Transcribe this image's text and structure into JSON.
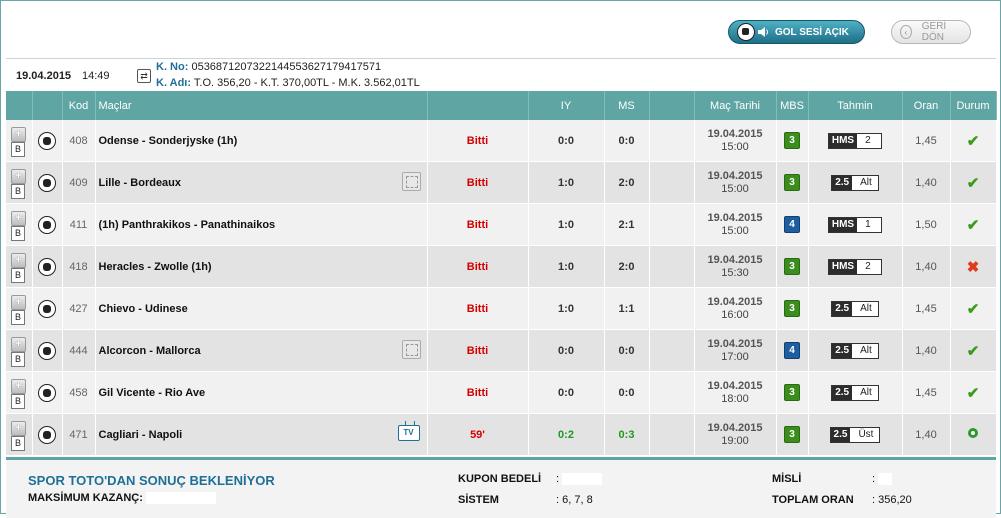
{
  "header": {
    "gol_button": "GOL SESİ AÇIK",
    "geri_button": "GERİ DÖN"
  },
  "coupon": {
    "date": "19.04.2015",
    "time": "14:49",
    "kno_label": "K. No:",
    "kno_value": "0536871207322144553627179417571",
    "kadi_label": "K. Adı:",
    "kadi_value": "T.O. 356,20 - K.T. 370,00TL - M.K. 3.562,01TL"
  },
  "columns": {
    "kod": "Kod",
    "maclar": "Maçlar",
    "iy": "IY",
    "ms": "MS",
    "mac_tarihi": "Maç Tarihi",
    "mbs": "MBS",
    "tahmin": "Tahmin",
    "oran": "Oran",
    "durum": "Durum"
  },
  "rows": [
    {
      "kod": "408",
      "mac": "Odense - Sonderjyske (1h)",
      "status": "Bitti",
      "iy": "0:0",
      "ms": "0:0",
      "date": "19.04.2015",
      "time": "15:00",
      "mbs": "3",
      "mbs_color": "green",
      "tahmin_key": "HMS",
      "tahmin_val": "2",
      "oran": "1,45",
      "durum": "won",
      "icon": ""
    },
    {
      "kod": "409",
      "mac": "Lille - Bordeaux",
      "status": "Bitti",
      "iy": "1:0",
      "ms": "2:0",
      "date": "19.04.2015",
      "time": "15:00",
      "mbs": "3",
      "mbs_color": "green",
      "tahmin_key": "2.5",
      "tahmin_val": "Alt",
      "oran": "1,40",
      "durum": "won",
      "icon": "stats"
    },
    {
      "kod": "411",
      "mac": "(1h) Panthrakikos - Panathinaikos",
      "status": "Bitti",
      "iy": "1:0",
      "ms": "2:1",
      "date": "19.04.2015",
      "time": "15:00",
      "mbs": "4",
      "mbs_color": "blue",
      "tahmin_key": "HMS",
      "tahmin_val": "1",
      "oran": "1,50",
      "durum": "won",
      "icon": ""
    },
    {
      "kod": "418",
      "mac": "Heracles - Zwolle (1h)",
      "status": "Bitti",
      "iy": "1:0",
      "ms": "2:0",
      "date": "19.04.2015",
      "time": "15:30",
      "mbs": "3",
      "mbs_color": "green",
      "tahmin_key": "HMS",
      "tahmin_val": "2",
      "oran": "1,40",
      "durum": "lost",
      "icon": ""
    },
    {
      "kod": "427",
      "mac": "Chievo - Udinese",
      "status": "Bitti",
      "iy": "1:0",
      "ms": "1:1",
      "date": "19.04.2015",
      "time": "16:00",
      "mbs": "3",
      "mbs_color": "green",
      "tahmin_key": "2.5",
      "tahmin_val": "Alt",
      "oran": "1,45",
      "durum": "won",
      "icon": ""
    },
    {
      "kod": "444",
      "mac": "Alcorcon - Mallorca",
      "status": "Bitti",
      "iy": "0:0",
      "ms": "0:0",
      "date": "19.04.2015",
      "time": "17:00",
      "mbs": "4",
      "mbs_color": "blue",
      "tahmin_key": "2.5",
      "tahmin_val": "Alt",
      "oran": "1,40",
      "durum": "won",
      "icon": "stats"
    },
    {
      "kod": "458",
      "mac": "Gil Vicente - Rio Ave",
      "status": "Bitti",
      "iy": "0:0",
      "ms": "0:0",
      "date": "19.04.2015",
      "time": "18:00",
      "mbs": "3",
      "mbs_color": "green",
      "tahmin_key": "2.5",
      "tahmin_val": "Alt",
      "oran": "1,45",
      "durum": "won",
      "icon": ""
    },
    {
      "kod": "471",
      "mac": "Cagliari - Napoli",
      "status": "59'",
      "iy": "0:2",
      "ms": "0:3",
      "date": "19.04.2015",
      "time": "19:00",
      "mbs": "3",
      "mbs_color": "green",
      "tahmin_key": "2.5",
      "tahmin_val": "Üst",
      "oran": "1,40",
      "durum": "live",
      "icon": "tv"
    }
  ],
  "footer": {
    "status": "SPOR TOTO'DAN SONUÇ BEKLENİYOR",
    "max_kazanc_label": "MAKSİMUM KAZANÇ:",
    "kupon_bedeli_label": "KUPON BEDELİ",
    "kupon_bedeli_value": ":",
    "sistem_label": "SİSTEM",
    "sistem_value": ": 6, 7, 8",
    "misli_label": "MİSLİ",
    "misli_value": ":",
    "toplam_oran_label": "TOPLAM ORAN",
    "toplam_oran_value": ": 356,20"
  }
}
